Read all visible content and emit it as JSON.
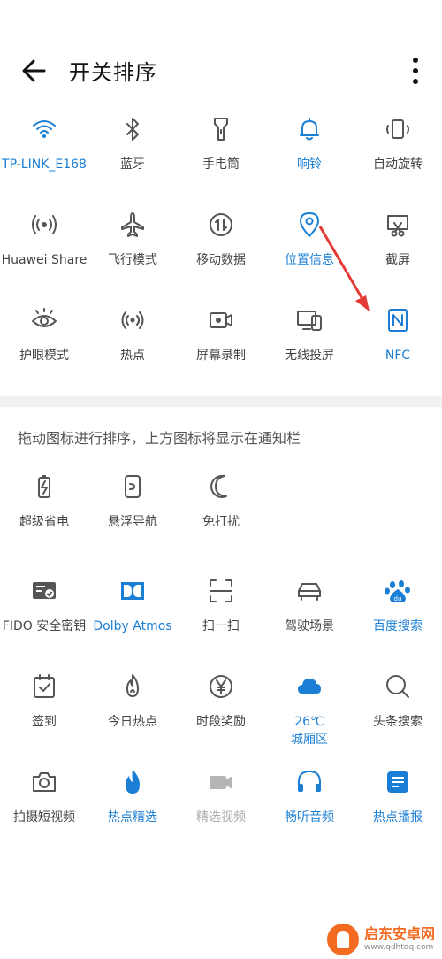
{
  "header": {
    "title": "开关排序"
  },
  "top_items": [
    {
      "label": "TP-LINK_E168",
      "icon": "wifi-icon",
      "state": "on"
    },
    {
      "label": "蓝牙",
      "icon": "bluetooth-icon",
      "state": "off"
    },
    {
      "label": "手电筒",
      "icon": "flashlight-icon",
      "state": "off"
    },
    {
      "label": "响铃",
      "icon": "bell-icon",
      "state": "on"
    },
    {
      "label": "自动旋转",
      "icon": "auto-rotate-icon",
      "state": "off"
    },
    {
      "label": "Huawei Share",
      "icon": "huawei-share-icon",
      "state": "off"
    },
    {
      "label": "飞行模式",
      "icon": "airplane-icon",
      "state": "off"
    },
    {
      "label": "移动数据",
      "icon": "mobile-data-icon",
      "state": "off"
    },
    {
      "label": "位置信息",
      "icon": "location-icon",
      "state": "on"
    },
    {
      "label": "截屏",
      "icon": "screenshot-icon",
      "state": "off"
    },
    {
      "label": "护眼模式",
      "icon": "eye-icon",
      "state": "off"
    },
    {
      "label": "热点",
      "icon": "hotspot-icon",
      "state": "off"
    },
    {
      "label": "屏幕录制",
      "icon": "screen-record-icon",
      "state": "off"
    },
    {
      "label": "无线投屏",
      "icon": "wireless-projection-icon",
      "state": "off"
    },
    {
      "label": "NFC",
      "icon": "nfc-icon",
      "state": "on"
    }
  ],
  "hint": "拖动图标进行排序，上方图标将显示在通知栏",
  "bottom_items": [
    {
      "label": "超级省电",
      "icon": "battery-saver-icon",
      "state": "off"
    },
    {
      "label": "悬浮导航",
      "icon": "floating-nav-icon",
      "state": "off"
    },
    {
      "label": "免打扰",
      "icon": "moon-icon",
      "state": "off"
    },
    {
      "label": "FIDO 安全密钥",
      "icon": "fido-key-icon",
      "state": "off"
    },
    {
      "label": "Dolby Atmos",
      "icon": "dolby-icon",
      "state": "on"
    },
    {
      "label": "扫一扫",
      "icon": "scan-icon",
      "state": "off"
    },
    {
      "label": "驾驶场景",
      "icon": "car-icon",
      "state": "off"
    },
    {
      "label": "百度搜索",
      "icon": "baidu-icon",
      "state": "on"
    },
    {
      "label": "签到",
      "icon": "checkin-icon",
      "state": "off"
    },
    {
      "label": "今日热点",
      "icon": "flame-outline-icon",
      "state": "off"
    },
    {
      "label": "时段奖励",
      "icon": "yen-icon",
      "state": "off"
    },
    {
      "label": "26℃\n城厢区",
      "icon": "cloud-icon",
      "state": "on"
    },
    {
      "label": "头条搜索",
      "icon": "search-icon",
      "state": "off"
    },
    {
      "label": "拍摄短视频",
      "icon": "camera-icon",
      "state": "off"
    },
    {
      "label": "热点精选",
      "icon": "flame-icon",
      "state": "on"
    },
    {
      "label": "精选视频",
      "icon": "video-icon",
      "state": "dim"
    },
    {
      "label": "畅听音频",
      "icon": "headphones-icon",
      "state": "on"
    },
    {
      "label": "热点播报",
      "icon": "news-icon",
      "state": "on"
    }
  ],
  "watermark": {
    "name": "启东安卓网",
    "url": "www.qdhtdq.com"
  },
  "colors": {
    "accent": "#1a7fd4",
    "arrow": "#e53935",
    "text": "#444444"
  }
}
